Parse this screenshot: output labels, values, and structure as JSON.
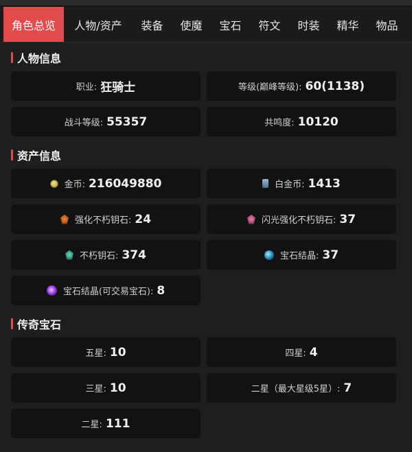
{
  "tabs": [
    {
      "label": "角色总览",
      "active": true
    },
    {
      "label": "人物/资产"
    },
    {
      "label": "装备"
    },
    {
      "label": "使魔"
    },
    {
      "label": "宝石"
    },
    {
      "label": "符文"
    },
    {
      "label": "时装"
    },
    {
      "label": "精华"
    },
    {
      "label": "物品"
    }
  ],
  "sections": {
    "character": {
      "title": "人物信息",
      "items": [
        {
          "label": "职业:",
          "value": "狂骑士"
        },
        {
          "label": "等级(巅峰等级):",
          "value": "60(1138)"
        },
        {
          "label": "战斗等级:",
          "value": "55357"
        },
        {
          "label": "共鸣度:",
          "value": "10120"
        }
      ]
    },
    "assets": {
      "title": "资产信息",
      "items": [
        {
          "icon": "gold-coin-icon",
          "label": "金币:",
          "value": "216049880"
        },
        {
          "icon": "platinum-coin-icon",
          "label": "白金币:",
          "value": "1413"
        },
        {
          "icon": "enhanced-immortal-key-stone-icon",
          "label": "强化不朽钥石:",
          "value": "24"
        },
        {
          "icon": "shining-enhanced-immortal-key-stone-icon",
          "label": "闪光强化不朽钥石:",
          "value": "37"
        },
        {
          "icon": "immortal-key-stone-icon",
          "label": "不朽钥石:",
          "value": "374"
        },
        {
          "icon": "gem-crystal-icon",
          "label": "宝石结晶:",
          "value": "37"
        },
        {
          "icon": "tradable-gem-crystal-icon",
          "label": "宝石结晶(可交易宝石):",
          "value": "8"
        }
      ]
    },
    "legendary": {
      "title": "传奇宝石",
      "items": [
        {
          "label": "五星:",
          "value": "10"
        },
        {
          "label": "四星:",
          "value": "4"
        },
        {
          "label": "三星:",
          "value": "10"
        },
        {
          "label": "二星（最大星级5星）:",
          "value": "7"
        },
        {
          "label": "二星:",
          "value": "111"
        }
      ]
    }
  }
}
